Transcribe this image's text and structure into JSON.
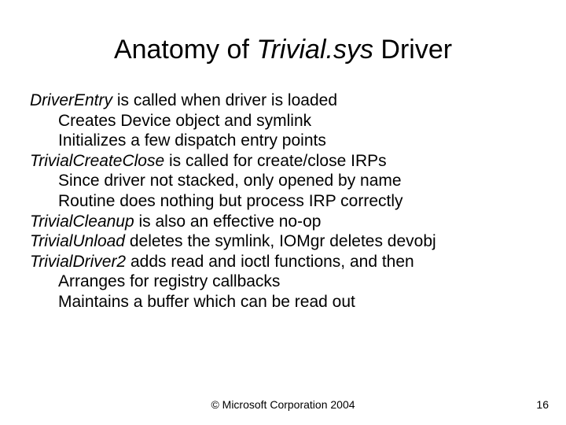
{
  "title": {
    "pre": "Anatomy of ",
    "italic": "Trivial.sys",
    "post": " Driver"
  },
  "lines": [
    {
      "italic": "DriverEntry",
      "rest": " is called when driver is loaded",
      "indent": false
    },
    {
      "italic": "",
      "rest": "Creates Device object and symlink",
      "indent": true
    },
    {
      "italic": "",
      "rest": "Initializes a few dispatch entry points",
      "indent": true
    },
    {
      "italic": "TrivialCreateClose",
      "rest": " is called for create/close IRPs",
      "indent": false
    },
    {
      "italic": "",
      "rest": "Since driver not stacked, only opened by name",
      "indent": true
    },
    {
      "italic": "",
      "rest": "Routine does nothing but process IRP correctly",
      "indent": true
    },
    {
      "italic": "TrivialCleanup",
      "rest": " is also an effective no-op",
      "indent": false
    },
    {
      "italic": "TrivialUnload",
      "rest": " deletes the symlink, IOMgr deletes devobj",
      "indent": false
    },
    {
      "italic": "TrivialDriver2",
      "rest": " adds read and ioctl functions, and then",
      "indent": false
    },
    {
      "italic": "",
      "rest": "Arranges for registry callbacks",
      "indent": true
    },
    {
      "italic": "",
      "rest": "Maintains a buffer which can be read out",
      "indent": true
    }
  ],
  "footer": "© Microsoft Corporation 2004",
  "pagenum": "16"
}
